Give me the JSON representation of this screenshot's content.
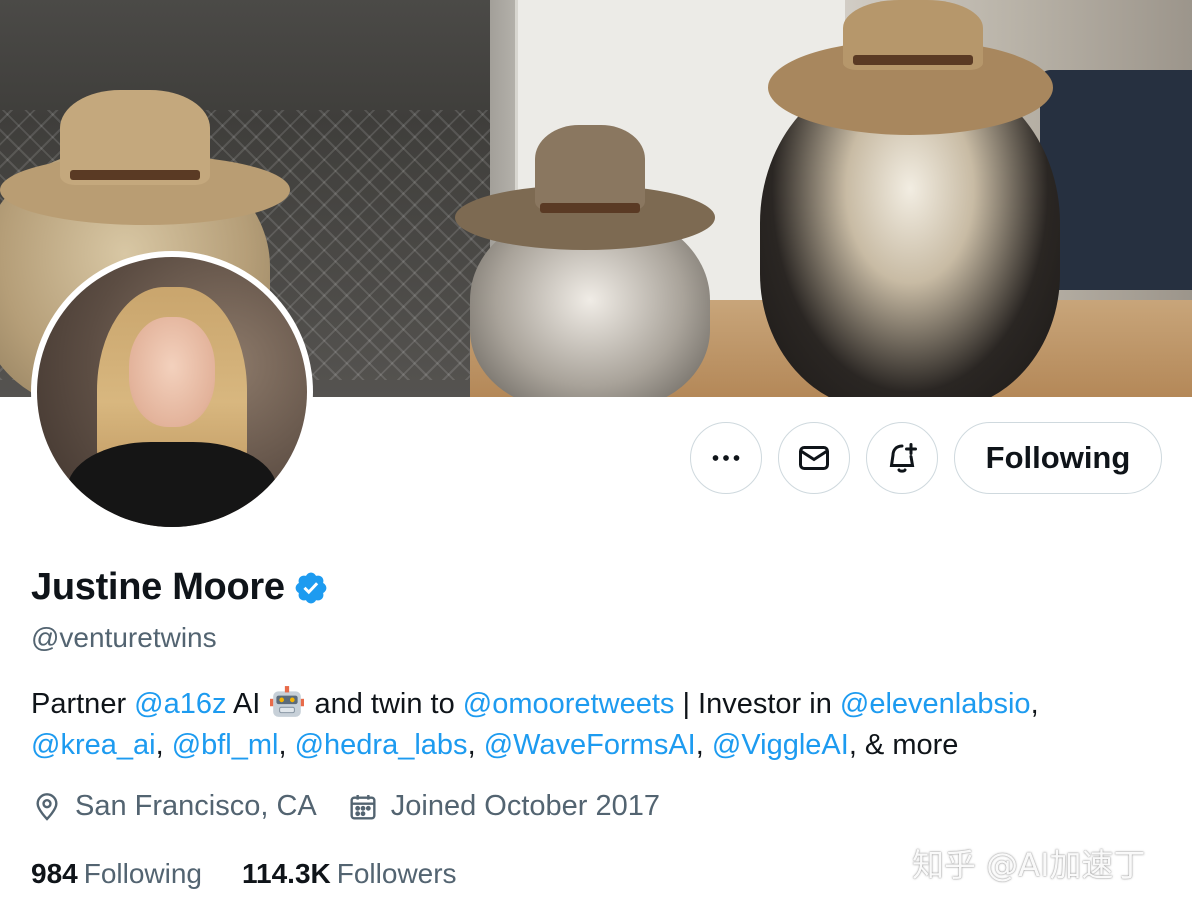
{
  "profile": {
    "name": "Justine Moore",
    "handle": "@venturetwins",
    "bio": {
      "t1": "Partner ",
      "m1": "@a16z",
      "t2": " AI ",
      "t3": " and twin to ",
      "m2": "@omooretweets",
      "t4": " | Investor in ",
      "m3": "@elevenlabsio",
      "t5": ",",
      "m4": "@krea_ai",
      "t6": ", ",
      "m5": "@bfl_ml",
      "t7": ", ",
      "m6": "@hedra_labs",
      "t8": ", ",
      "m7": "@WaveFormsAI",
      "t9": ", ",
      "m8": "@ViggleAI",
      "t10": ", & more"
    },
    "location": "San Francisco, CA",
    "joined": "Joined October 2017",
    "following_count": "984",
    "following_label": "Following",
    "followers_count": "114.3K",
    "followers_label": "Followers"
  },
  "actions": {
    "follow_label": "Following"
  },
  "icons": {
    "more": "more-icon",
    "message": "mail-icon",
    "notify": "bell-plus-icon",
    "verified": "verified-badge-icon",
    "location": "location-pin-icon",
    "calendar": "calendar-icon",
    "emoji": "robot-emoji"
  },
  "colors": {
    "link": "#1d9bf0",
    "text": "#0f1419",
    "secondary": "#536471",
    "border": "#cfd9de"
  },
  "watermark": "知乎 @AI加速丁"
}
